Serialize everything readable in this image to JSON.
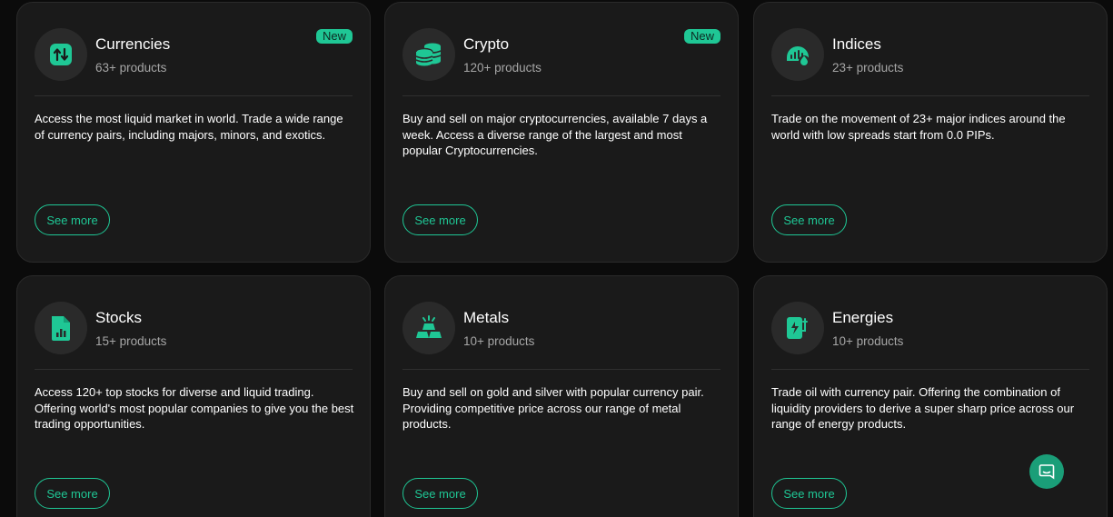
{
  "colors": {
    "accent": "#1fc795",
    "card_bg": "#1a1a1a",
    "page_bg": "#0b0b0b"
  },
  "cards": [
    {
      "title": "Currencies",
      "subtitle": "63+ products",
      "badge": "New",
      "icon": "currency-exchange-icon",
      "description": "Access the most liquid market in world. Trade a wide range of currency pairs, including majors, minors, and exotics.",
      "button_label": "See more"
    },
    {
      "title": "Crypto",
      "subtitle": "120+ products",
      "badge": "New",
      "icon": "coin-stack-icon",
      "description": "Buy and sell on major cryptocurrencies, available 7 days a week. Access a diverse range of the largest and most popular Cryptocurrencies.",
      "button_label": "See more"
    },
    {
      "title": "Indices",
      "subtitle": "23+ products",
      "badge": "",
      "icon": "gauge-icon",
      "description": "Trade on the movement of 23+ major indices around the world with low spreads start from 0.0 PIPs.",
      "button_label": "See more"
    },
    {
      "title": "Stocks",
      "subtitle": "15+ products",
      "badge": "",
      "icon": "document-chart-icon",
      "description": "Access 120+ top stocks for diverse and liquid trading. Offering world's most popular companies to give you the best trading opportunities.",
      "button_label": "See more"
    },
    {
      "title": "Metals",
      "subtitle": "10+ products",
      "badge": "",
      "icon": "gold-bars-icon",
      "description": "Buy and sell on gold and silver with popular currency pair. Providing competitive price across our range of metal products.",
      "button_label": "See more"
    },
    {
      "title": "Energies",
      "subtitle": "10+ products",
      "badge": "",
      "icon": "energy-plug-icon",
      "description": "Trade oil with currency pair. Offering the combination of liquidity providers to derive a super sharp price across our range of energy products.",
      "button_label": "See more"
    }
  ],
  "chat": {
    "icon": "chat-bubble-icon"
  }
}
